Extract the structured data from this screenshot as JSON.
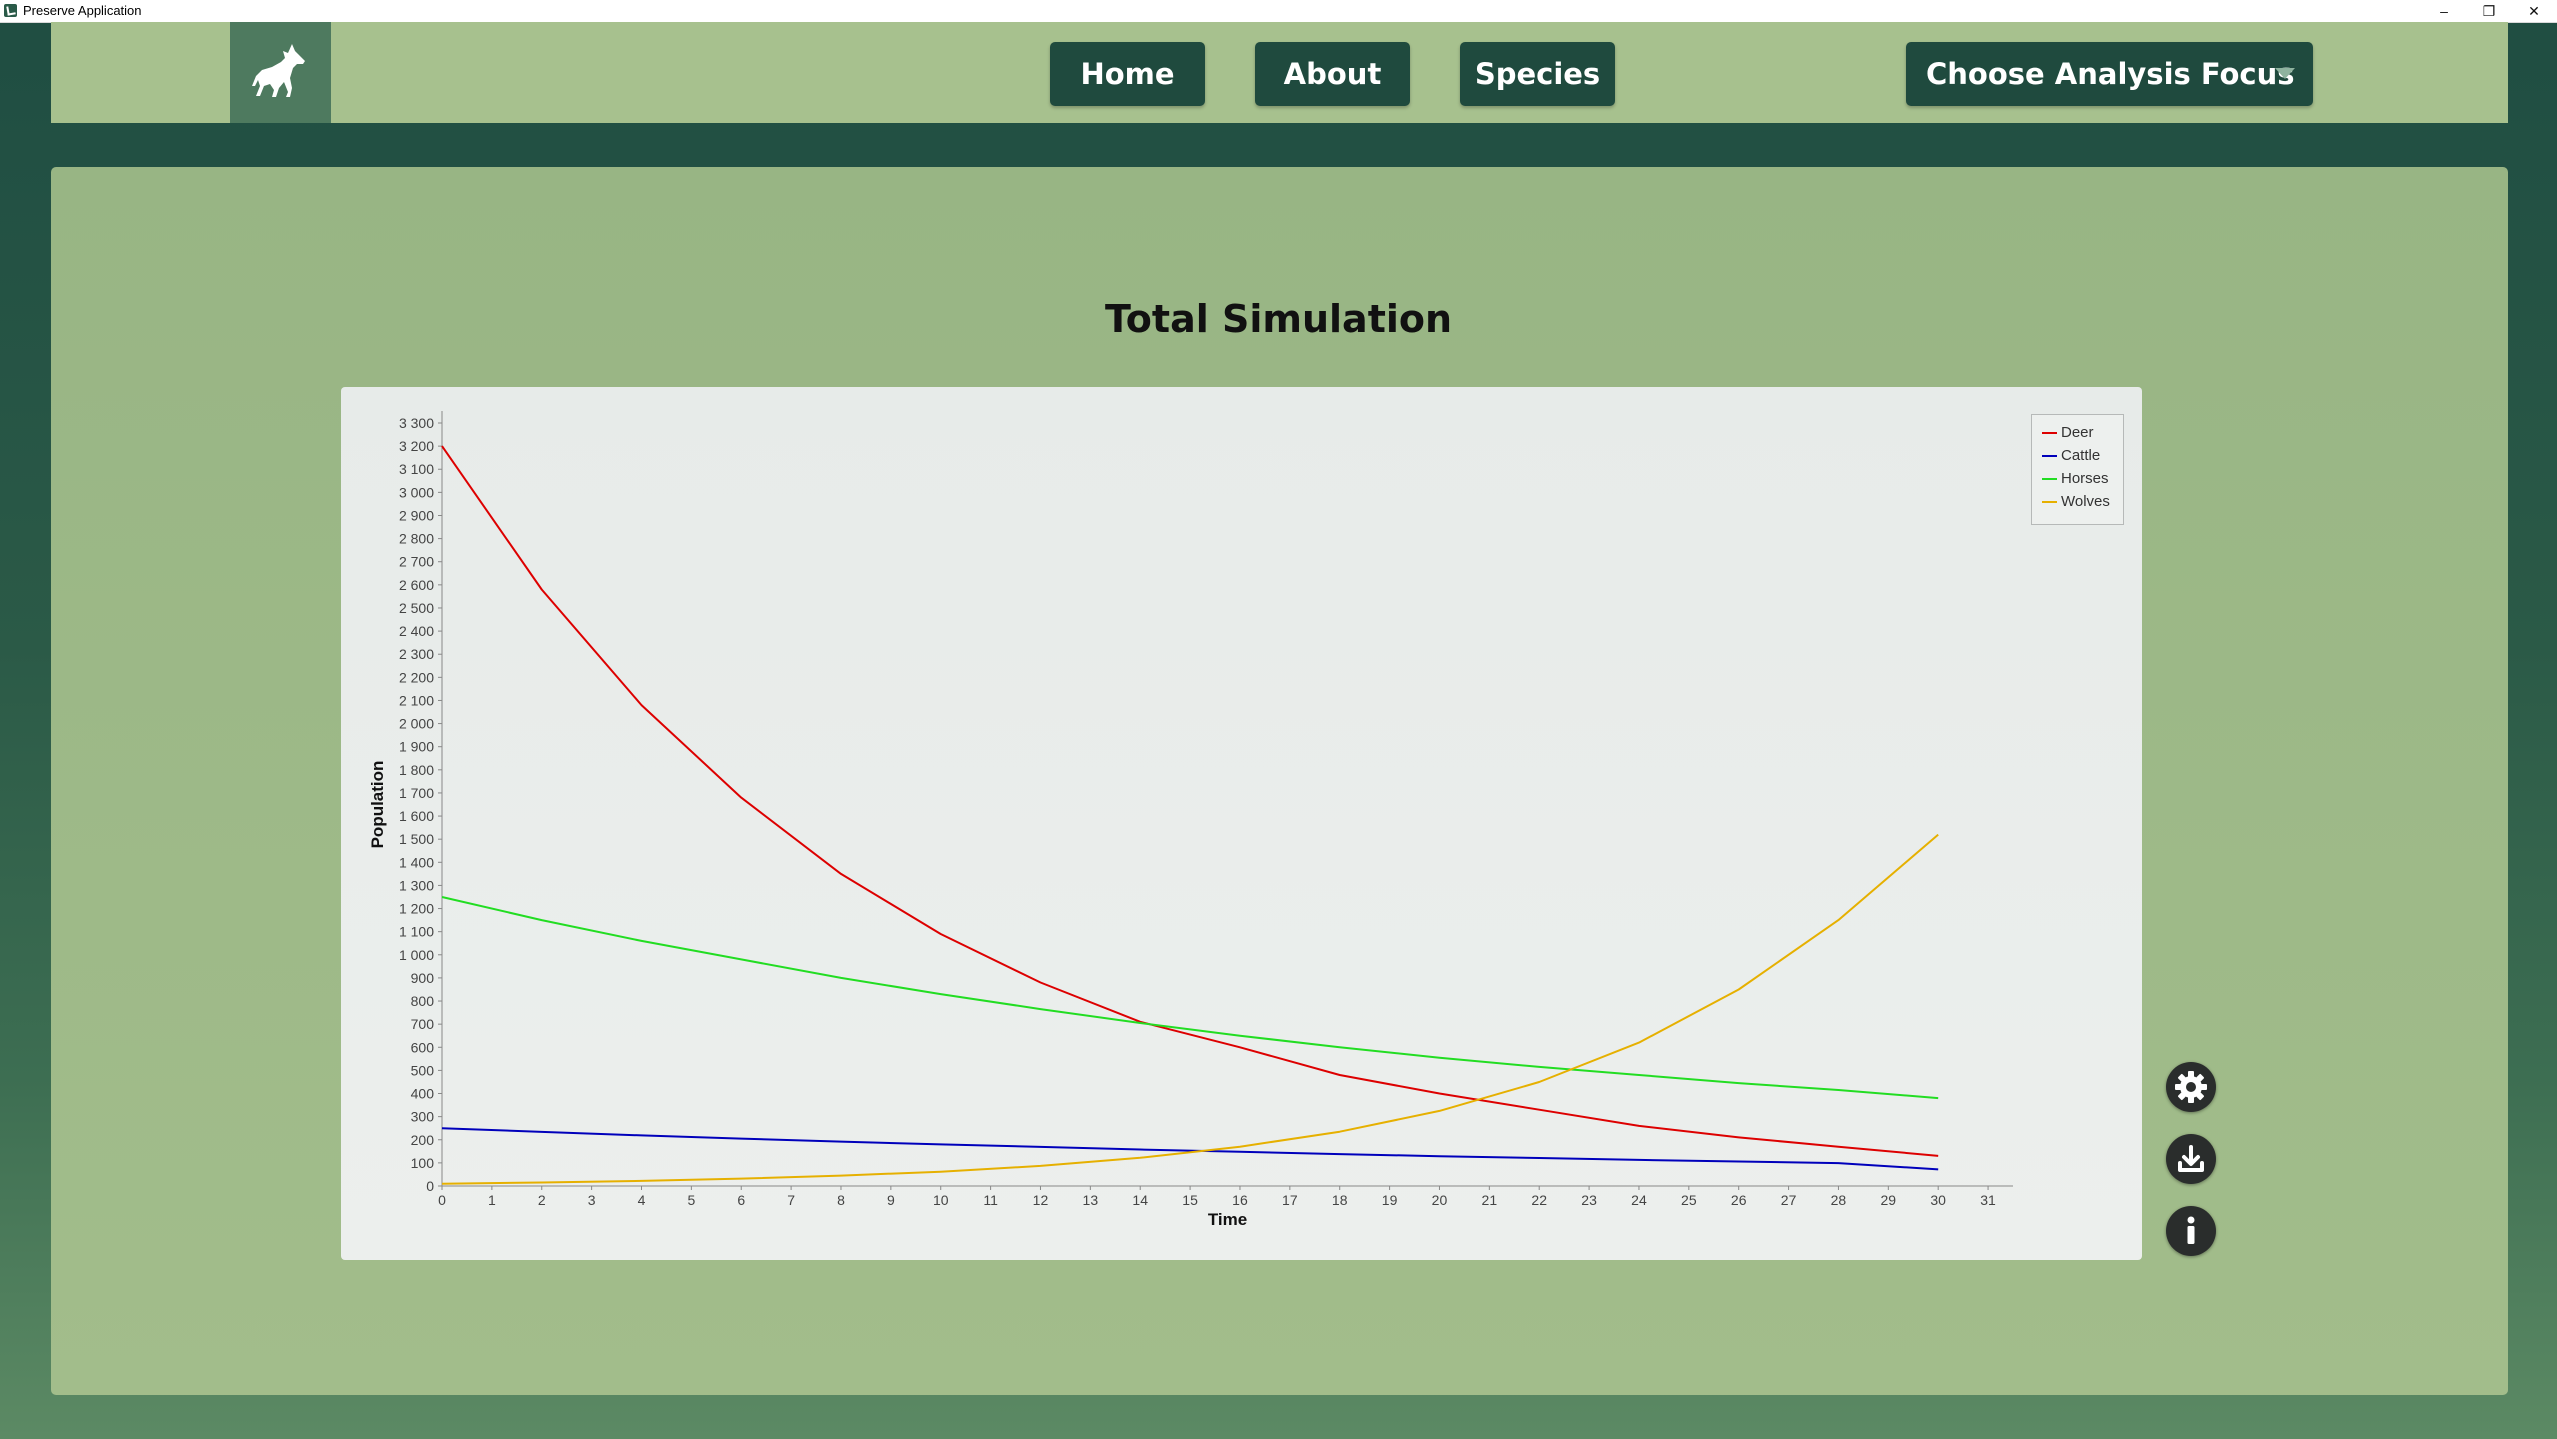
{
  "window": {
    "title": "Preserve Application",
    "controls": [
      "minimize-icon",
      "restore-icon",
      "close-icon"
    ]
  },
  "navbar": {
    "logo": "wolf-icon",
    "buttons": [
      "Home",
      "About",
      "Species"
    ],
    "dropdown": {
      "selected": "Choose Analysis Focus",
      "icon": "chevron-down-icon"
    }
  },
  "main": {
    "title": "Total Simulation",
    "side_buttons": [
      "gear-icon",
      "download-icon",
      "info-icon"
    ]
  },
  "colors": {
    "nav_bg": "#a7c18e",
    "button_bg": "#1f4a3e",
    "panel_bg": "#9db887",
    "deer": "#dd0000",
    "cattle": "#0000bb",
    "horses": "#22dd22",
    "wolves": "#e6b000"
  },
  "chart_data": {
    "type": "line",
    "xlabel": "Time",
    "ylabel": "Population",
    "xlim": [
      0,
      31.5
    ],
    "ylim": [
      0,
      3300
    ],
    "x_ticks": [
      "0",
      "1",
      "2",
      "3",
      "4",
      "5",
      "6",
      "7",
      "8",
      "9",
      "10",
      "11",
      "12",
      "13",
      "14",
      "15",
      "16",
      "17",
      "18",
      "19",
      "20",
      "21",
      "22",
      "23",
      "24",
      "25",
      "26",
      "27",
      "28",
      "29",
      "30",
      "31"
    ],
    "y_ticks": [
      "0",
      "100",
      "200",
      "300",
      "400",
      "500",
      "600",
      "700",
      "800",
      "900",
      "1 000",
      "1 100",
      "1 200",
      "1 300",
      "1 400",
      "1 500",
      "1 600",
      "1 700",
      "1 800",
      "1 900",
      "2 000",
      "2 100",
      "2 200",
      "2 300",
      "2 400",
      "2 500",
      "2 600",
      "2 700",
      "2 800",
      "2 900",
      "3 000",
      "3 100",
      "3 200",
      "3 300"
    ],
    "legend_position": "top-right",
    "x": [
      0,
      2,
      4,
      6,
      8,
      10,
      12,
      14,
      16,
      18,
      20,
      22,
      24,
      26,
      28,
      30
    ],
    "series": [
      {
        "name": "Deer",
        "color": "#dd0000",
        "values": [
          3200,
          2580,
          2080,
          1680,
          1350,
          1090,
          880,
          710,
          600,
          480,
          400,
          330,
          260,
          210,
          170,
          130
        ]
      },
      {
        "name": "Cattle",
        "color": "#0000bb",
        "values": [
          250,
          234,
          219,
          205,
          192,
          180,
          169,
          158,
          148,
          138,
          129,
          121,
          113,
          106,
          99,
          72
        ]
      },
      {
        "name": "Horses",
        "color": "#22dd22",
        "values": [
          1250,
          1150,
          1060,
          980,
          900,
          830,
          765,
          705,
          650,
          600,
          555,
          515,
          480,
          445,
          415,
          380
        ]
      },
      {
        "name": "Wolves",
        "color": "#e6b000",
        "values": [
          10,
          15,
          22,
          32,
          45,
          62,
          87,
          122,
          170,
          235,
          325,
          450,
          620,
          850,
          1150,
          1520
        ]
      }
    ]
  }
}
